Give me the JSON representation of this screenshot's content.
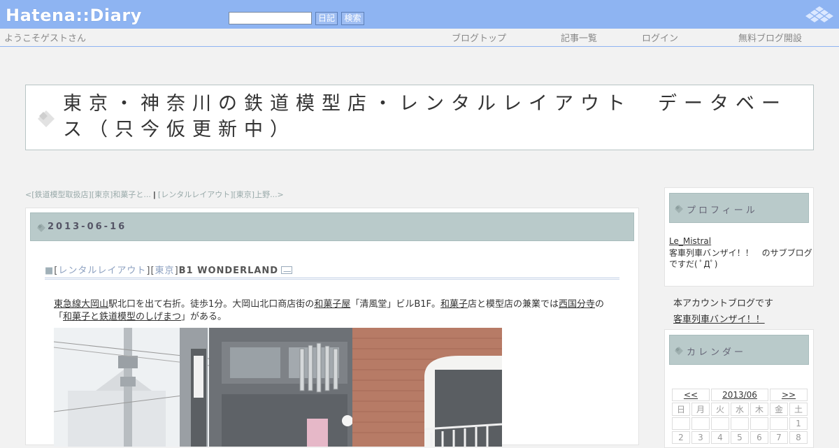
{
  "topbar": {
    "logo": "Hatena::Diary",
    "search_placeholder": "",
    "diary_button": "日記",
    "search_button": "検索"
  },
  "subnav": {
    "welcome": "ようこそゲストさん",
    "links": [
      "ブログトップ",
      "記事一覧",
      "ログイン",
      "無料ブログ開設"
    ]
  },
  "blog": {
    "title": "東京・神奈川の鉄道模型店・レンタルレイアウト　データベース（只今仮更新中）"
  },
  "pager": {
    "prev": "<[鉄道模型取扱店][東京]和菓子と...",
    "separator": "|",
    "next": "[レンタルレイアウト][東京]上野...>"
  },
  "entry": {
    "date": "2013-06-16",
    "section": {
      "marker": "■",
      "cat1": "レンタルレイアウト",
      "cat2": "東京",
      "title": "B1 WONDERLAND"
    },
    "body": {
      "l1a": "東急線",
      "l1b": "大岡山",
      "l1c": "駅北口を出て右折。徒歩1分。大岡山北口商店街の",
      "l1d": "和菓子屋",
      "l1e": "「清風堂」ビルB1F。",
      "l1f": "和菓子",
      "l1g": "店と模型店の兼業では",
      "l1h": "西国分寺",
      "l1i": "の",
      "l2a": "「",
      "l2b": "和菓子と鉄道模型のしげまつ",
      "l2c": "」がある。"
    }
  },
  "sidebar": {
    "profile": {
      "heading": "プロフィール",
      "name": "Le_Mistral",
      "desc": "客車列車バンザイ！！　のサブブログですだ( ﾟДﾟ)"
    },
    "note": "本アカウントブログです",
    "link": "客車列車バンザイ！！",
    "calendar": {
      "heading": "カレンダー",
      "prev": "<<",
      "month": "2013/06",
      "next": ">>",
      "weekdays": [
        "日",
        "月",
        "火",
        "水",
        "木",
        "金",
        "土"
      ],
      "row1": [
        "",
        "",
        "",
        "",
        "",
        "",
        "1"
      ],
      "row2": [
        "2",
        "3",
        "4",
        "5",
        "6",
        "7",
        "8"
      ]
    }
  },
  "colors": {
    "topbar": "#8eb4f2",
    "header_band": "#b9caca",
    "background": "#f2f2f2"
  }
}
